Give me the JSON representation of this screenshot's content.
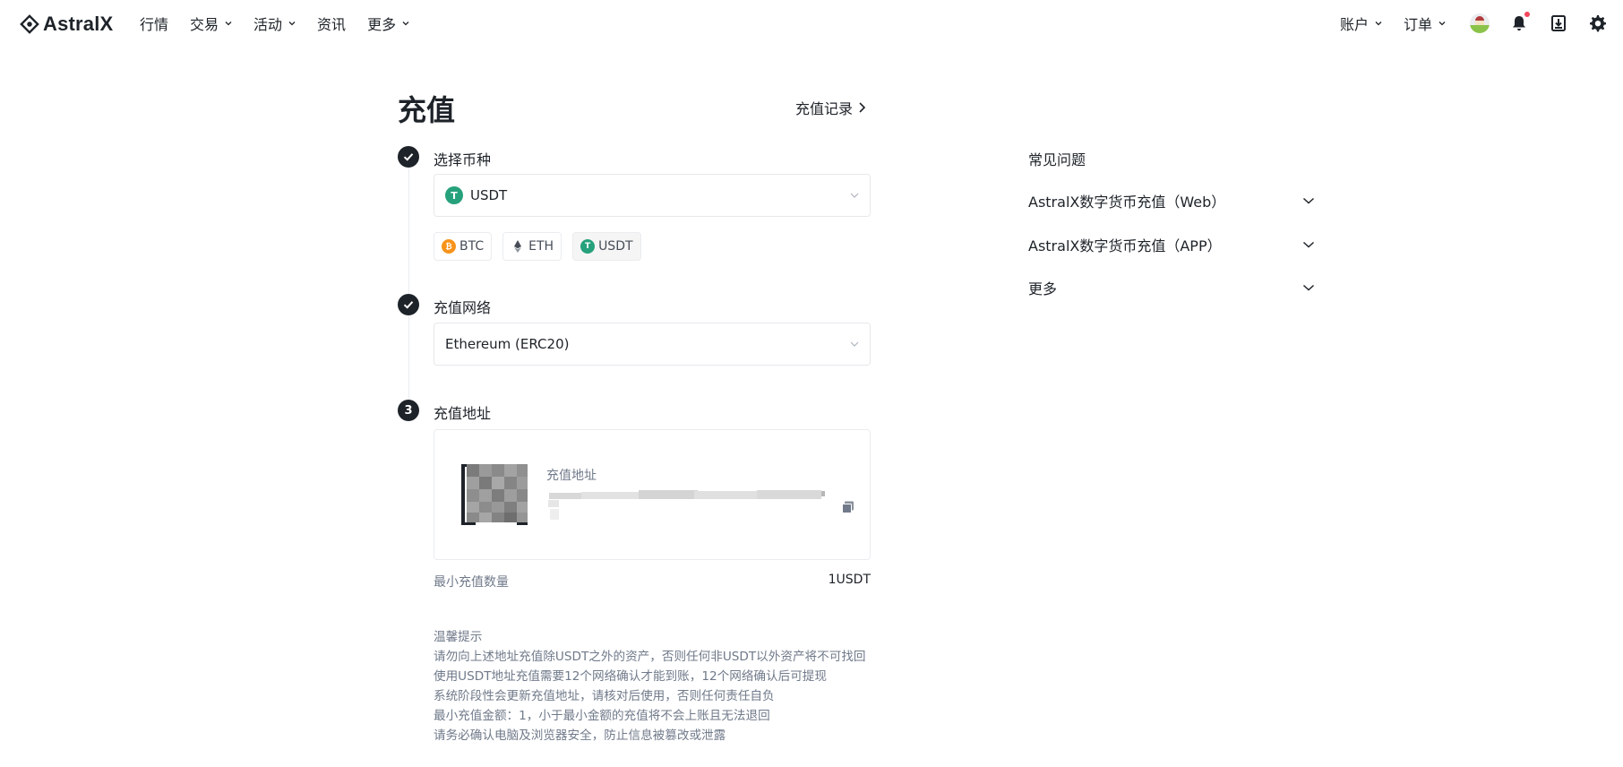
{
  "brand": {
    "name": "AstralX"
  },
  "nav": {
    "left": [
      {
        "label": "行情",
        "has_caret": false
      },
      {
        "label": "交易",
        "has_caret": true
      },
      {
        "label": "活动",
        "has_caret": true
      },
      {
        "label": "资讯",
        "has_caret": false
      },
      {
        "label": "更多",
        "has_caret": true
      }
    ],
    "right": [
      {
        "label": "账户",
        "has_caret": true
      },
      {
        "label": "订单",
        "has_caret": true
      }
    ],
    "icons": [
      "avatar",
      "bell-icon",
      "download-icon",
      "gear-icon"
    ]
  },
  "page": {
    "title": "充值",
    "history_link": "充值记录"
  },
  "steps": {
    "coin": {
      "label": "选择币种",
      "selected": "USDT",
      "chips": [
        "BTC",
        "ETH",
        "USDT"
      ],
      "active_chip": "USDT"
    },
    "network": {
      "label": "充值网络",
      "selected": "Ethereum (ERC20)"
    },
    "address": {
      "number": "3",
      "label": "充值地址",
      "card_label": "充值地址"
    }
  },
  "min_deposit": {
    "label": "最小充值数量",
    "value": "1USDT"
  },
  "tips": {
    "title": "温馨提示",
    "lines": [
      "请勿向上述地址充值除USDT之外的资产，否则任何非USDT以外资产将不可找回",
      "使用USDT地址充值需要12个网络确认才能到账，12个网络确认后可提现",
      "系统阶段性会更新充值地址，请核对后使用，否则任何责任自负",
      "最小充值金额：1，小于最小金额的充值将不会上账且无法退回",
      "请务必确认电脑及浏览器安全，防止信息被篡改或泄露"
    ]
  },
  "faq": {
    "title": "常见问题",
    "items": [
      "AstralX数字货币充值（Web）",
      "AstralX数字货币充值（APP）",
      "更多"
    ]
  },
  "colors": {
    "text_primary": "#1e2329",
    "text_secondary": "#707a8a",
    "border": "#eaecef",
    "usdt": "#26a17b",
    "btc": "#f7931a",
    "notification": "#f6465d"
  }
}
